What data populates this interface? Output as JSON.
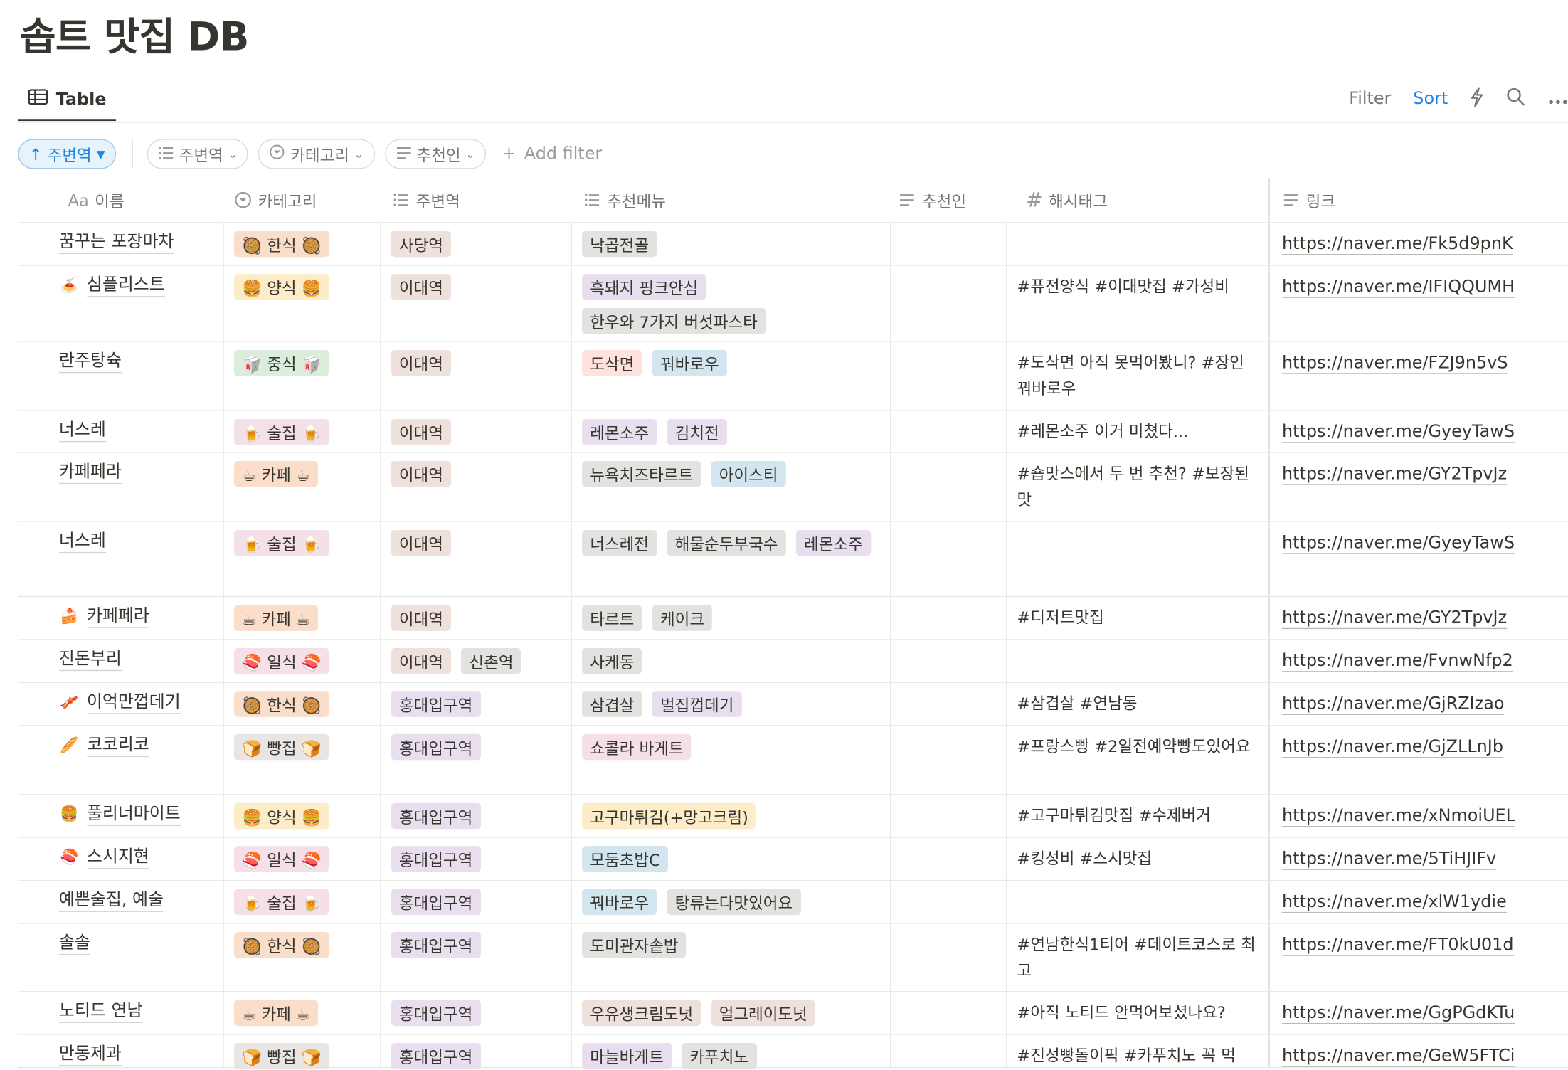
{
  "title": "솝트 맛집 DB",
  "view": {
    "tab_label": "Table",
    "filter_label": "Filter",
    "sort_label": "Sort"
  },
  "filters": {
    "sort_chip": "주변역",
    "chips": [
      "주변역",
      "카테고리",
      "추천인"
    ],
    "add_filter": "Add filter"
  },
  "columns": {
    "name": "이름",
    "name_prefix": "Aa",
    "category": "카테고리",
    "station": "주변역",
    "menu": "추천메뉴",
    "recommender": "추천인",
    "hashtag": "해시태그",
    "link": "링크"
  },
  "rows": [
    {
      "emoji": "",
      "name": "꿈꾸는 포장마차",
      "cat": {
        "label": "🥘 한식 🥘",
        "color": "han"
      },
      "stations": [
        "사당역"
      ],
      "menus": [
        {
          "t": "낙곱전골",
          "c": "gray"
        }
      ],
      "hashtag": "",
      "link": "https://naver.me/Fk5d9pnK",
      "h": 42
    },
    {
      "emoji": "🍝",
      "name": "심플리스트",
      "cat": {
        "label": "🍔 양식 🍔",
        "color": "yang"
      },
      "stations": [
        "이대역"
      ],
      "menus": [
        {
          "t": "흑돼지 핑크안심",
          "c": "purple"
        },
        {
          "t": "한우와 7가지 버섯파스타",
          "c": "gray"
        }
      ],
      "hashtag": "#퓨전양식 #이대맛집 #가성비",
      "link": "https://naver.me/IFIQQUMH",
      "h": 75
    },
    {
      "emoji": "",
      "name": "란주탕슉",
      "cat": {
        "label": "🥡 중식 🥡",
        "color": "jung"
      },
      "stations": [
        "이대역"
      ],
      "menus": [
        {
          "t": "도삭면",
          "c": "red"
        },
        {
          "t": "꿔바로우",
          "c": "blue"
        }
      ],
      "hashtag": "#도삭면 아직 못먹어봤니? #장인 꿔바로우",
      "link": "https://naver.me/FZJ9n5vS",
      "h": 68
    },
    {
      "emoji": "",
      "name": "너스레",
      "cat": {
        "label": "🍺 술집 🍺",
        "color": "sul"
      },
      "stations": [
        "이대역"
      ],
      "menus": [
        {
          "t": "레몬소주",
          "c": "purple"
        },
        {
          "t": "김치전",
          "c": "purple"
        }
      ],
      "hashtag": "#레몬소주 이거 미쳤다...",
      "link": "https://naver.me/GyeyTawS",
      "h": 41
    },
    {
      "emoji": "",
      "name": "카페페라",
      "cat": {
        "label": "☕ 카페 ☕",
        "color": "cafe"
      },
      "stations": [
        "이대역"
      ],
      "menus": [
        {
          "t": "뉴욕치즈타르트",
          "c": "gray"
        },
        {
          "t": "아이스티",
          "c": "blue"
        }
      ],
      "hashtag": "#숍맛스에서 두 번 추천? #보장된 맛",
      "link": "https://naver.me/GY2TpvJz",
      "h": 68
    },
    {
      "emoji": "",
      "name": "너스레",
      "cat": {
        "label": "🍺 술집 🍺",
        "color": "sul"
      },
      "stations": [
        "이대역"
      ],
      "menus": [
        {
          "t": "너스레전",
          "c": "gray"
        },
        {
          "t": "해물순두부국수",
          "c": "gray"
        },
        {
          "t": "레몬소주",
          "c": "purple"
        }
      ],
      "hashtag": "",
      "link": "https://naver.me/GyeyTawS",
      "h": 74
    },
    {
      "emoji": "🍰",
      "name": "카페페라",
      "cat": {
        "label": "☕ 카페 ☕",
        "color": "cafe"
      },
      "stations": [
        "이대역"
      ],
      "menus": [
        {
          "t": "타르트",
          "c": "gray"
        },
        {
          "t": "케이크",
          "c": "gray"
        }
      ],
      "hashtag": "#디저트맛집",
      "link": "https://naver.me/GY2TpvJz",
      "h": 42
    },
    {
      "emoji": "",
      "name": "진돈부리",
      "cat": {
        "label": "🍣 일식 🍣",
        "color": "il"
      },
      "stations": [
        "이대역",
        "신촌역"
      ],
      "menus": [
        {
          "t": "사케동",
          "c": "gray"
        }
      ],
      "hashtag": "",
      "link": "https://naver.me/FvnwNfp2",
      "h": 42
    },
    {
      "emoji": "🥓",
      "name": "이억만껍데기",
      "cat": {
        "label": "🥘 한식 🥘",
        "color": "han"
      },
      "stations": [
        "홍대입구역"
      ],
      "menus": [
        {
          "t": "삼겹살",
          "c": "gray"
        },
        {
          "t": "벌집껍데기",
          "c": "purple"
        }
      ],
      "hashtag": "#삼겹살 #연남동",
      "link": "https://naver.me/GjRZIzao",
      "h": 42
    },
    {
      "emoji": "🥖",
      "name": "코코리코",
      "cat": {
        "label": "🍞 빵집 🍞",
        "color": "bbang"
      },
      "stations": [
        "홍대입구역"
      ],
      "menus": [
        {
          "t": "쇼콜라 바게트",
          "c": "pink"
        }
      ],
      "hashtag": "#프랑스빵 #2일전예약빵도있어요",
      "link": "https://naver.me/GjZLLnJb",
      "h": 68
    },
    {
      "emoji": "🍔",
      "name": "풀리너마이트",
      "cat": {
        "label": "🍔 양식 🍔",
        "color": "yang"
      },
      "stations": [
        "홍대입구역"
      ],
      "menus": [
        {
          "t": "고구마튀김(+망고크림)",
          "c": "yellow"
        }
      ],
      "hashtag": "#고구마튀김맛집 #수제버거",
      "link": "https://naver.me/xNmoiUEL",
      "h": 42
    },
    {
      "emoji": "🍣",
      "name": "스시지현",
      "cat": {
        "label": "🍣 일식 🍣",
        "color": "il"
      },
      "stations": [
        "홍대입구역"
      ],
      "menus": [
        {
          "t": "모둠초밥C",
          "c": "blue"
        }
      ],
      "hashtag": "#킹성비 #스시맛집",
      "link": "https://naver.me/5TiHJIFv",
      "h": 42
    },
    {
      "emoji": "",
      "name": "예쁜술집, 예술",
      "cat": {
        "label": "🍺 술집 🍺",
        "color": "sul"
      },
      "stations": [
        "홍대입구역"
      ],
      "menus": [
        {
          "t": "꿔바로우",
          "c": "blue"
        },
        {
          "t": "탕류는다맛있어요",
          "c": "gray"
        }
      ],
      "hashtag": "",
      "link": "https://naver.me/xlW1ydie",
      "h": 42
    },
    {
      "emoji": "",
      "name": "솔솔",
      "cat": {
        "label": "🥘 한식 🥘",
        "color": "han"
      },
      "stations": [
        "홍대입구역"
      ],
      "menus": [
        {
          "t": "도미관자솥밥",
          "c": "gray"
        }
      ],
      "hashtag": "#연남한식1티어 #데이트코스로 최고",
      "link": "https://naver.me/FT0kU01d",
      "h": 67
    },
    {
      "emoji": "",
      "name": "노티드 연남",
      "cat": {
        "label": "☕ 카페 ☕",
        "color": "cafe"
      },
      "stations": [
        "홍대입구역"
      ],
      "menus": [
        {
          "t": "우유생크림도넛",
          "c": "brown"
        },
        {
          "t": "얼그레이도넛",
          "c": "brown"
        }
      ],
      "hashtag": "#아직 노티드 안먹어보셨나요?",
      "link": "https://naver.me/GgPGdKTu",
      "h": 42
    },
    {
      "emoji": "",
      "name": "만동제과",
      "cat": {
        "label": "🍞 빵집 🍞",
        "color": "bbang"
      },
      "stations": [
        "홍대입구역"
      ],
      "menus": [
        {
          "t": "마늘바게트",
          "c": "purple"
        },
        {
          "t": "카푸치노",
          "c": "gray"
        }
      ],
      "hashtag": "#진성빵돌이픽 #카푸치노 꼭 먹",
      "link": "https://naver.me/GeW5FTCi",
      "h": 32
    }
  ]
}
